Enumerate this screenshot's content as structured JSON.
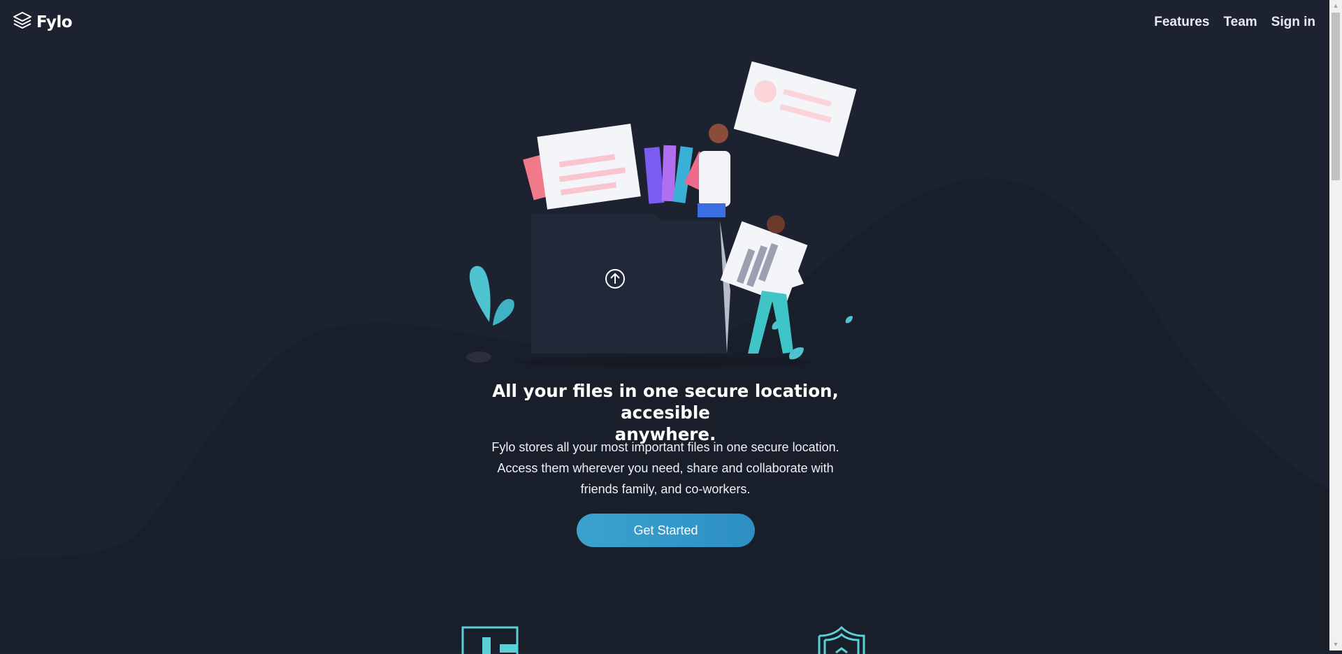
{
  "brand": {
    "name": "Fylo",
    "logo_icon": "layers-icon"
  },
  "nav": {
    "items": [
      {
        "label": "Features"
      },
      {
        "label": "Team"
      },
      {
        "label": "Sign in"
      }
    ]
  },
  "hero": {
    "illustration_icon": "upload-arrow-icon",
    "title_line1": "All your files in one secure location, accesible",
    "title_line2": "anywhere.",
    "text_line1": "Fylo stores all your most important files in one secure location.",
    "text_line2": "Access them wherever you need, share and collaborate with",
    "text_line3": "friends family, and co-workers.",
    "cta_label": "Get Started"
  },
  "features": {
    "icons": [
      "access-anywhere-icon",
      "security-shield-icon"
    ]
  },
  "colors": {
    "background": "#1c2230",
    "curve": "#181e2a",
    "accent_teal": "#5bd0d6",
    "cta_start": "#3ba2cf",
    "cta_end": "#2d8fc4"
  }
}
